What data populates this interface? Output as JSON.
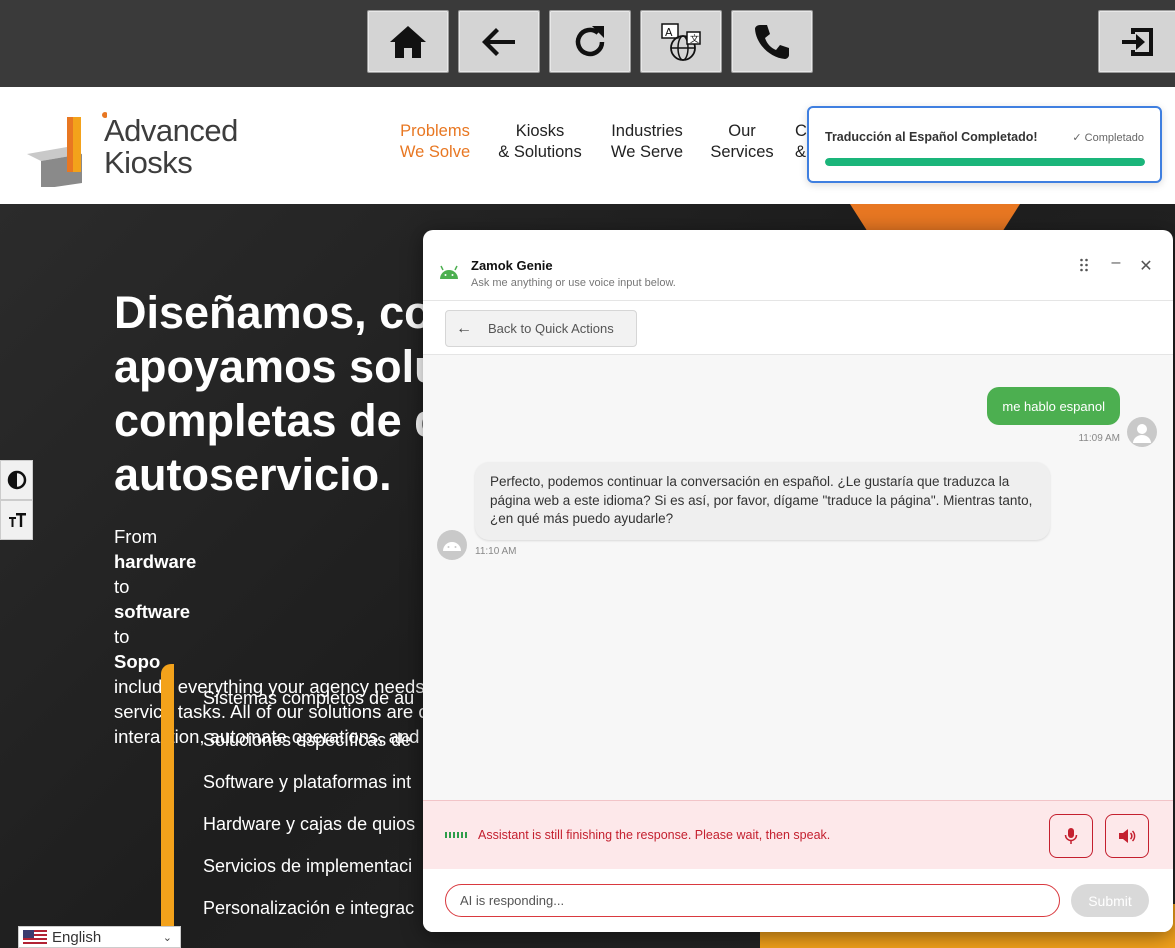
{
  "kiosk_toolbar": {
    "buttons": [
      {
        "name": "home-icon"
      },
      {
        "name": "back-arrow-icon"
      },
      {
        "name": "refresh-icon"
      },
      {
        "name": "translate-icon"
      },
      {
        "name": "phone-icon"
      }
    ],
    "exit": {
      "name": "exit-icon"
    }
  },
  "site": {
    "logo": {
      "line1": "Advanced",
      "line2": "Kiosks"
    },
    "nav": [
      {
        "line1": "Problems",
        "line2": "We Solve"
      },
      {
        "line1": "Kiosks",
        "line2": "& Solutions"
      },
      {
        "line1": "Industries",
        "line2": "We Serve"
      },
      {
        "line1": "Our",
        "line2": "Services"
      },
      {
        "line1": "C",
        "line2": "&"
      }
    ]
  },
  "toast": {
    "title": "Traducción al Español Completado!",
    "status": "✓ Completado",
    "progress": 1.0
  },
  "hero": {
    "heading": [
      "Diseñamos, con",
      "apoyamos solu",
      "completas de q",
      "autoservicio."
    ],
    "para_parts": {
      "from": "From ",
      "hardware": "hardware",
      "to1": " to ",
      "software": "software",
      "to2": " to ",
      "support": "Sopo"
    },
    "para_lines": [
      "include everything your agency needs",
      "service tasks. All of our solutions are c",
      "interaction, automate operations, and"
    ],
    "list": [
      "Sistemas completos de au",
      "Soluciones específicas de",
      "Software y plataformas int",
      "Hardware y cajas de quios",
      "Servicios de implementaci",
      "Personalización e integrac"
    ]
  },
  "language": {
    "selected": "English"
  },
  "chat": {
    "title": "Zamok Genie",
    "subtitle": "Ask me anything or use voice input below.",
    "back_label": "Back to Quick Actions",
    "user_message": "me hablo espanol",
    "user_time": "11:09 AM",
    "bot_message": "Perfecto, podemos continuar la conversación en español. ¿Le gustaría que traduzca la página web a este idioma? Si es así, por favor, dígame \"traduce la página\". Mientras tanto, ¿en qué más puedo ayudarle?",
    "bot_time": "11:10 AM",
    "status_text": "Assistant is still finishing the response. Please wait, then speak.",
    "input_placeholder": "AI is responding...",
    "submit_label": "Submit",
    "colors": {
      "user_bubble": "#4caf50",
      "status_error": "#c4202f",
      "toast_border": "#3f7fe0",
      "toast_fill": "#1ab57a",
      "brand_orange": "#e87722"
    }
  }
}
